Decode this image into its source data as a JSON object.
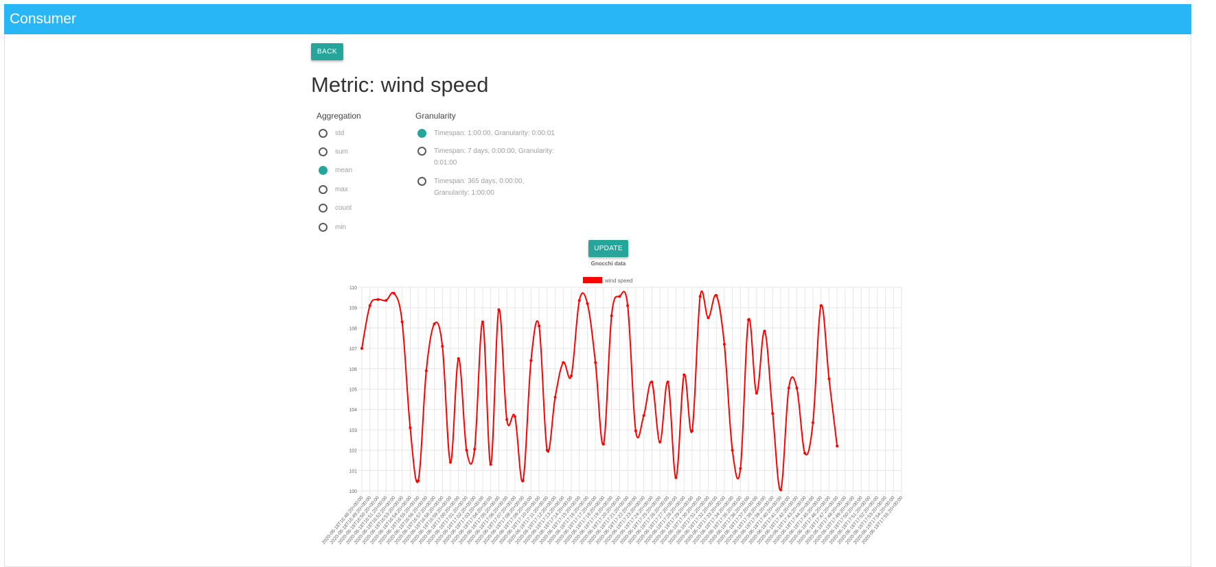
{
  "app": {
    "title": "Consumer"
  },
  "back_label": "BACK",
  "page_title": "Metric: wind speed",
  "aggregation": {
    "label": "Aggregation",
    "options": [
      "std",
      "sum",
      "mean",
      "max",
      "count",
      "min"
    ],
    "selected": "mean"
  },
  "granularity": {
    "label": "Granularity",
    "options": [
      {
        "line1": "Timespan: 1:00:00, Granularity: 0:00:01",
        "line2": ""
      },
      {
        "line1": "Timespan: 7 days, 0:00:00, Granularity:",
        "line2": "0:01:00"
      },
      {
        "line1": "Timespan: 365 days, 0:00:00,",
        "line2": "Granularity: 1:00:00"
      }
    ],
    "selected_index": 0
  },
  "update_label": "UPDATE",
  "colors": {
    "appbar": "#29b6f6",
    "accent": "#26a69a",
    "series": "#ff0000"
  },
  "chart_data": {
    "type": "line",
    "title": "Gnocchi data",
    "legend_position": "top",
    "grid": true,
    "ylim": [
      100,
      110
    ],
    "y_ticks": [
      100,
      101,
      102,
      103,
      104,
      105,
      106,
      107,
      108,
      109,
      110
    ],
    "x": [
      "2020-06-18T16:48:20+00:00",
      "2020-06-18T16:49:20+00:00",
      "2020-06-18T16:50:20+00:00",
      "2020-06-18T16:51:20+00:00",
      "2020-06-18T16:52:20+00:00",
      "2020-06-18T16:53:20+00:00",
      "2020-06-18T16:54:20+00:00",
      "2020-06-18T16:55:20+00:00",
      "2020-06-18T16:56:20+00:00",
      "2020-06-18T16:57:20+00:00",
      "2020-06-18T16:58:20+00:00",
      "2020-06-18T16:59:20+00:00",
      "2020-06-18T17:00:20+00:00",
      "2020-06-18T17:01:20+00:00",
      "2020-06-18T17:02:20+00:00",
      "2020-06-18T17:03:20+00:00",
      "2020-06-18T17:04:20+00:00",
      "2020-06-18T17:05:20+00:00",
      "2020-06-18T17:06:20+00:00",
      "2020-06-18T17:07:20+00:00",
      "2020-06-18T17:08:20+00:00",
      "2020-06-18T17:09:20+00:00",
      "2020-06-18T17:10:20+00:00",
      "2020-06-18T17:11:20+00:00",
      "2020-06-18T17:12:20+00:00",
      "2020-06-18T17:13:20+00:00",
      "2020-06-18T17:14:20+00:00",
      "2020-06-18T17:15:20+00:00",
      "2020-06-18T17:16:20+00:00",
      "2020-06-18T17:17:20+00:00",
      "2020-06-18T17:18:20+00:00",
      "2020-06-18T17:19:20+00:00",
      "2020-06-18T17:20:20+00:00",
      "2020-06-18T17:21:20+00:00",
      "2020-06-18T17:22:20+00:00",
      "2020-06-18T17:23:20+00:00",
      "2020-06-18T17:24:20+00:00",
      "2020-06-18T17:25:20+00:00",
      "2020-06-18T17:26:20+00:00",
      "2020-06-18T17:27:20+00:00",
      "2020-06-18T17:28:20+00:00",
      "2020-06-18T17:29:20+00:00",
      "2020-06-18T17:30:20+00:00",
      "2020-06-18T17:31:20+00:00",
      "2020-06-18T17:32:20+00:00",
      "2020-06-18T17:33:20+00:00",
      "2020-06-18T17:34:20+00:00",
      "2020-06-18T17:35:20+00:00",
      "2020-06-18T17:36:20+00:00",
      "2020-06-18T17:37:20+00:00",
      "2020-06-18T17:38:20+00:00",
      "2020-06-18T17:39:20+00:00",
      "2020-06-18T17:40:20+00:00",
      "2020-06-18T17:41:20+00:00",
      "2020-06-18T17:42:20+00:00",
      "2020-06-18T17:43:20+00:00",
      "2020-06-18T17:44:20+00:00",
      "2020-06-18T17:45:20+00:00",
      "2020-06-18T17:46:20+00:00",
      "2020-06-18T17:47:20+00:00",
      "2020-06-18T17:48:20+00:00",
      "2020-06-18T17:49:20+00:00",
      "2020-06-18T17:50:20+00:00",
      "2020-06-18T17:51:20+00:00",
      "2020-06-18T17:52:20+00:00",
      "2020-06-18T17:53:20+00:00",
      "2020-06-18T17:54:20+00:00",
      "2020-06-18T17:55:20+00:00"
    ],
    "series": [
      {
        "name": "wind speed",
        "values": [
          107.0,
          109.1,
          109.4,
          109.35,
          109.7,
          108.3,
          103.1,
          100.5,
          105.9,
          108.2,
          107.1,
          101.4,
          106.5,
          102.0,
          102.05,
          108.3,
          101.3,
          108.9,
          103.5,
          103.65,
          100.5,
          106.4,
          108.1,
          102.0,
          104.6,
          106.3,
          105.65,
          109.35,
          109.2,
          106.3,
          102.3,
          108.6,
          109.55,
          109.1,
          102.95,
          103.7,
          105.35,
          102.4,
          105.35,
          100.65,
          105.7,
          102.95,
          109.55,
          108.5,
          109.6,
          107.2,
          102.0,
          101.1,
          108.4,
          104.8,
          107.85,
          103.8,
          100.05,
          105.05,
          105.05,
          101.85,
          103.35,
          109.1,
          105.5,
          102.2
        ]
      }
    ]
  }
}
